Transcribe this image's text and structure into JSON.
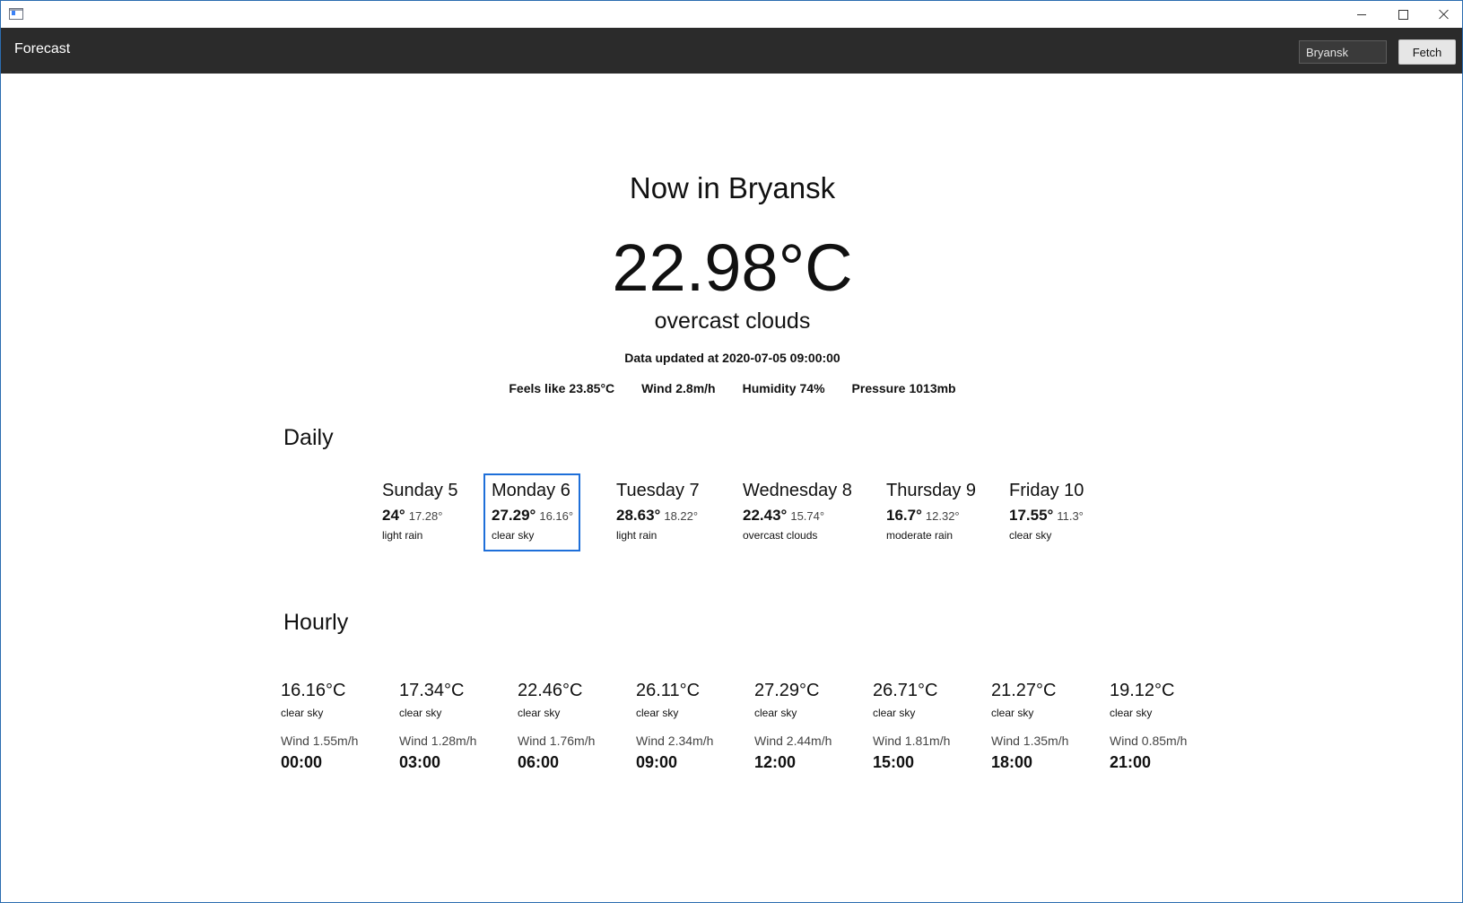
{
  "window": {
    "buttons": {
      "minimize": "minimize-icon",
      "maximize": "maximize-icon",
      "close": "close-icon"
    }
  },
  "appbar": {
    "title": "Forecast",
    "search": {
      "value": "Bryansk",
      "placeholder": ""
    },
    "fetch_label": "Fetch"
  },
  "now": {
    "title": "Now in Bryansk",
    "temperature": "22.98°C",
    "description": "overcast clouds",
    "updated": "Data updated at 2020-07-05 09:00:00",
    "stats": [
      {
        "label": "Feels like",
        "value": "23.85°C"
      },
      {
        "label": "Wind",
        "value": "2.8m/h"
      },
      {
        "label": "Humidity",
        "value": "74%"
      },
      {
        "label": "Pressure",
        "value": "1013mb"
      }
    ]
  },
  "daily": {
    "title": "Daily",
    "days": [
      {
        "name": "Sunday 5",
        "max": "24°",
        "min": "17.28°",
        "desc": "light rain"
      },
      {
        "name": "Monday 6",
        "max": "27.29°",
        "min": "16.16°",
        "desc": "clear sky"
      },
      {
        "name": "Tuesday 7",
        "max": "28.63°",
        "min": "18.22°",
        "desc": "light rain"
      },
      {
        "name": "Wednesday 8",
        "max": "22.43°",
        "min": "15.74°",
        "desc": "overcast clouds"
      },
      {
        "name": "Thursday 9",
        "max": "16.7°",
        "min": "12.32°",
        "desc": "moderate rain"
      },
      {
        "name": "Friday 10",
        "max": "17.55°",
        "min": "11.3°",
        "desc": "clear sky"
      }
    ],
    "selected_index": 1,
    "selection_color": "#1e6fd9"
  },
  "hourly": {
    "title": "Hourly",
    "hours": [
      {
        "temp": "16.16°C",
        "desc": "clear sky",
        "wind": "Wind 1.55m/h",
        "time": "00:00"
      },
      {
        "temp": "17.34°C",
        "desc": "clear sky",
        "wind": "Wind 1.28m/h",
        "time": "03:00"
      },
      {
        "temp": "22.46°C",
        "desc": "clear sky",
        "wind": "Wind 1.76m/h",
        "time": "06:00"
      },
      {
        "temp": "26.11°C",
        "desc": "clear sky",
        "wind": "Wind 2.34m/h",
        "time": "09:00"
      },
      {
        "temp": "27.29°C",
        "desc": "clear sky",
        "wind": "Wind 2.44m/h",
        "time": "12:00"
      },
      {
        "temp": "26.71°C",
        "desc": "clear sky",
        "wind": "Wind 1.81m/h",
        "time": "15:00"
      },
      {
        "temp": "21.27°C",
        "desc": "clear sky",
        "wind": "Wind 1.35m/h",
        "time": "18:00"
      },
      {
        "temp": "19.12°C",
        "desc": "clear sky",
        "wind": "Wind 0.85m/h",
        "time": "21:00"
      }
    ]
  },
  "colors": {
    "appbar_bg": "#2b2b2b",
    "accent": "#1e6fd9"
  }
}
